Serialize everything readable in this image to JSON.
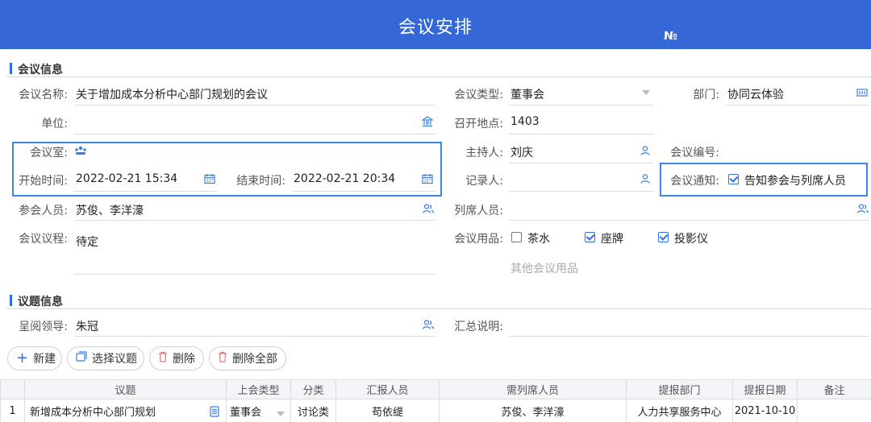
{
  "header": {
    "title": "会议安排",
    "no_label": "№"
  },
  "section_meeting": {
    "title": "会议信息"
  },
  "section_topics": {
    "title": "议题信息"
  },
  "form": {
    "meeting_name_label": "会议名称:",
    "meeting_name_value": "关于增加成本分析中心部门规划的会议",
    "meeting_type_label": "会议类型:",
    "meeting_type_value": "董事会",
    "department_label": "部门:",
    "department_value": "协同云体验",
    "unit_label": "单位:",
    "unit_value": "",
    "location_label": "召开地点:",
    "location_value": "1403",
    "meeting_room_label": "会议室:",
    "host_label": "主持人:",
    "host_value": "刘庆",
    "meeting_no_label": "会议编号:",
    "meeting_no_value": "",
    "start_label": "开始时间:",
    "start_value": "2022-02-21 15:34",
    "end_label": "结束时间:",
    "end_value": "2022-02-21 20:34",
    "recorder_label": "记录人:",
    "recorder_value": "",
    "notice_label": "会议通知:",
    "notice_option": "告知参会与列席人员",
    "notice_checked": true,
    "attendees_label": "参会人员:",
    "attendees_value": "苏俊、李洋濠",
    "observers_label": "列席人员:",
    "observers_value": "",
    "agenda_label": "会议议程:",
    "agenda_value": "待定",
    "supplies_label": "会议用品:",
    "supplies": [
      {
        "label": "茶水",
        "checked": false
      },
      {
        "label": "座牌",
        "checked": true
      },
      {
        "label": "投影仪",
        "checked": true
      }
    ],
    "other_supplies_placeholder": "其他会议用品",
    "reviewer_label": "呈阅领导:",
    "reviewer_value": "朱冠",
    "summary_label": "汇总说明:",
    "summary_value": ""
  },
  "toolbar": {
    "new_label": "新建",
    "select_label": "选择议题",
    "delete_label": "删除",
    "delete_all_label": "删除全部"
  },
  "table": {
    "headers": [
      "",
      "议题",
      "上会类型",
      "分类",
      "汇报人员",
      "需列席人员",
      "提报部门",
      "提报日期",
      "备注"
    ],
    "rows": [
      [
        "1",
        "新增成本分析中心部门规划",
        "董事会",
        "讨论类",
        "苟依缇",
        "苏俊、李洋濠",
        "人力共享服务中心",
        "2021-10-10",
        ""
      ]
    ]
  },
  "colors": {
    "header_bg": "#3567d6",
    "accent": "#2f6fe0",
    "highlight_border": "#3b86e8"
  }
}
